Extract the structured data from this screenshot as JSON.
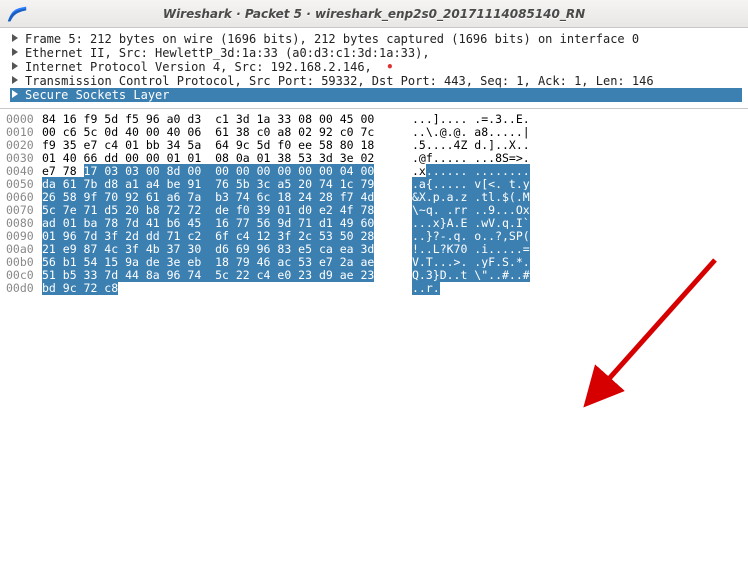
{
  "window": {
    "title": "Wireshark · Packet 5 · wireshark_enp2s0_20171114085140_RN"
  },
  "tree": {
    "rows": [
      {
        "label": "Frame 5: 212 bytes on wire (1696 bits), 212 bytes captured (1696 bits) on interface 0",
        "selected": false
      },
      {
        "label": "Ethernet II, Src: HewlettP_3d:1a:33 (a0:d3:c1:3d:1a:33),",
        "selected": false
      },
      {
        "label": "Internet Protocol Version 4, Src: 192.168.2.146,  ",
        "selected": false,
        "dot": true
      },
      {
        "label": "Transmission Control Protocol, Src Port: 59332, Dst Port: 443, Seq: 1, Ack: 1, Len: 146",
        "selected": false
      },
      {
        "label": "Secure Sockets Layer",
        "selected": true
      }
    ]
  },
  "hex": {
    "rows": [
      {
        "off": "0000",
        "b1": "84 16 f9 5d f5 96 a0 d3  c1 3d 1a 33 08 00 45 00",
        "a1": "...].... .=.3..E."
      },
      {
        "off": "0010",
        "b1": "00 c6 5c 0d 40 00 40 06  61 38 c0 a8 02 92 c0 7c",
        "a1": "..\\.@.@. a8.....|"
      },
      {
        "off": "0020",
        "b1": "f9 35 e7 c4 01 bb 34 5a  64 9c 5d f0 ee 58 80 18",
        "a1": ".5....4Z d.]..X.."
      },
      {
        "off": "0030",
        "b1": "01 40 66 dd 00 00 01 01  08 0a 01 38 53 3d 3e 02",
        "a1": ".@f..... ...8S=>."
      },
      {
        "off": "0040",
        "b1": "e7 78 ",
        "b2": "17 03 03 00 8d 00  00 00 00 00 00 00 04 00",
        "a1": ".x",
        "a2": "...... ........"
      },
      {
        "off": "0050",
        "b2": "da 61 7b d8 a1 a4 be 91  76 5b 3c a5 20 74 1c 79",
        "a2": ".a{..... v[<. t.y"
      },
      {
        "off": "0060",
        "b2": "26 58 9f 70 92 61 a6 7a  b3 74 6c 18 24 28 f7 4d",
        "a2": "&X.p.a.z .tl.$(.M"
      },
      {
        "off": "0070",
        "b2": "5c 7e 71 d5 20 b8 72 72  de f0 39 01 d0 e2 4f 78",
        "a2": "\\~q. .rr ..9...Ox"
      },
      {
        "off": "0080",
        "b2": "ad 01 ba 78 7d 41 b6 45  16 77 56 9d 71 d1 49 60",
        "a2": "...x}A.E .wV.q.I`"
      },
      {
        "off": "0090",
        "b2": "01 96 7d 3f 2d dd 71 c2  6f c4 12 3f 2c 53 50 28",
        "a2": "..}?-.q. o..?,SP("
      },
      {
        "off": "00a0",
        "b2": "21 e9 87 4c 3f 4b 37 30  d6 69 96 83 e5 ca ea 3d",
        "a2": "!..L?K70 .i.....="
      },
      {
        "off": "00b0",
        "b2": "56 b1 54 15 9a de 3e eb  18 79 46 ac 53 e7 2a ae",
        "a2": "V.T...>. .yF.S.*."
      },
      {
        "off": "00c0",
        "b2": "51 b5 33 7d 44 8a 96 74  5c 22 c4 e0 23 d9 ae 23",
        "a2": "Q.3}D..t \\\"..#..#"
      },
      {
        "off": "00d0",
        "b2": "bd 9c 72 c8",
        "a2": "..r."
      }
    ]
  },
  "icons": {
    "app_icon": "wireshark-fin",
    "expand_arrow": "triangle-right"
  }
}
